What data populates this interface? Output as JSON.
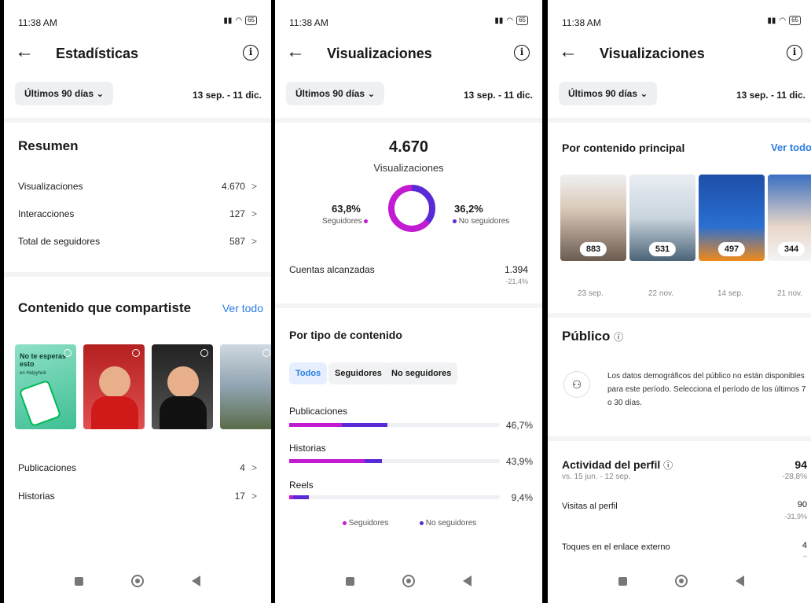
{
  "status": {
    "time": "11:38 AM",
    "battery": "65"
  },
  "screen1": {
    "title": "Estadísticas",
    "range_label": "Últimos 90 días",
    "dates": "13 sep. - 11 dic.",
    "summary_title": "Resumen",
    "summary_rows": [
      {
        "label": "Visualizaciones",
        "value": "4.670"
      },
      {
        "label": "Interacciones",
        "value": "127"
      },
      {
        "label": "Total de seguidores",
        "value": "587"
      }
    ],
    "shared_title": "Contenido que compartiste",
    "see_all": "Ver todo",
    "thumb1_text": "No te esperas esto",
    "thumb1_sub": "en Helpyhub",
    "content_rows": [
      {
        "label": "Publicaciones",
        "value": "4"
      },
      {
        "label": "Historias",
        "value": "17"
      }
    ]
  },
  "screen2": {
    "title": "Visualizaciones",
    "range_label": "Últimos 90 días",
    "dates": "13 sep. - 11 dic.",
    "total": "4.670",
    "total_label": "Visualizaciones",
    "followers_pct": "63,8%",
    "followers_label": "Seguidores",
    "nonfollowers_pct": "36,2%",
    "nonfollowers_label": "No seguidores",
    "reach_label": "Cuentas alcanzadas",
    "reach_value": "1.394",
    "reach_change": "-21,4%",
    "by_type_title": "Por tipo de contenido",
    "filters": [
      "Todos",
      "Seguidores",
      "No seguidores"
    ],
    "legend_followers": "Seguidores",
    "legend_nonfollowers": "No seguidores",
    "colors": {
      "followers": "#c21bd1",
      "nonfollowers": "#5a2ad6"
    }
  },
  "chart_data": {
    "type": "bar",
    "categories": [
      "Publicaciones",
      "Historias",
      "Reels"
    ],
    "totals_label": [
      "46,7%",
      "43,9%",
      "9,4%"
    ],
    "series": [
      {
        "name": "Seguidores",
        "values": [
          25,
          36,
          2
        ]
      },
      {
        "name": "No seguidores",
        "values": [
          21.7,
          7.9,
          7.4
        ]
      }
    ],
    "donut": [
      {
        "name": "Seguidores",
        "value": 63.8
      },
      {
        "name": "No seguidores",
        "value": 36.2
      }
    ],
    "ylim": [
      0,
      100
    ]
  },
  "screen3": {
    "title": "Visualizaciones",
    "range_label": "Últimos 90 días",
    "dates": "13 sep. - 11 dic.",
    "top_title": "Por contenido principal",
    "see_all": "Ver todo",
    "posts": [
      {
        "views": "883",
        "date": "23 sep."
      },
      {
        "views": "531",
        "date": "22 nov."
      },
      {
        "views": "497",
        "date": "14 sep."
      },
      {
        "views": "344",
        "date": "21 nov."
      }
    ],
    "audience_title": "Público",
    "audience_msg": "Los datos demográficos del público no están disponibles para este período. Selecciona el período de los últimos 7 o 30 días.",
    "activity_title": "Actividad del perfil",
    "activity_sub": "vs. 15 jun. - 12 sep.",
    "activity_value": "94",
    "activity_change": "-28,8%",
    "visits_label": "Visitas al perfil",
    "visits_value": "90",
    "visits_change": "-31,9%",
    "link_label": "Toques en el enlace externo",
    "link_value": "4",
    "link_change": "–"
  }
}
